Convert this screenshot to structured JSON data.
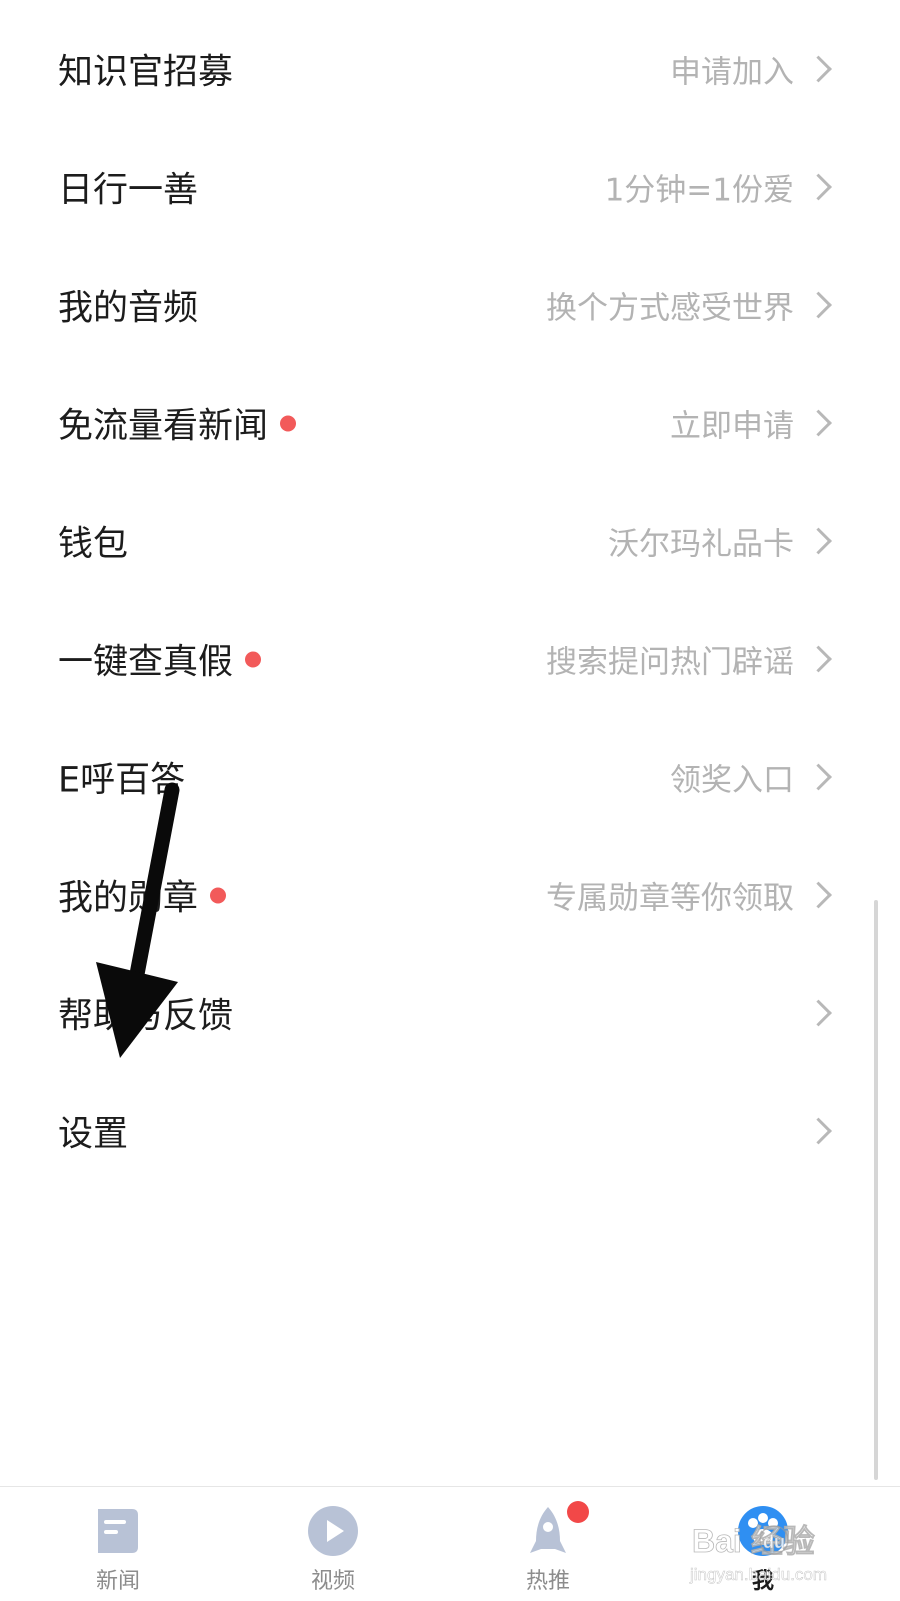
{
  "menu": {
    "items": [
      {
        "label": "知识官招募",
        "desc": "申请加入",
        "dot": false
      },
      {
        "label": "日行一善",
        "desc": "1分钟=1份爱",
        "dot": false
      },
      {
        "label": "我的音频",
        "desc": "换个方式感受世界",
        "dot": false
      },
      {
        "label": "免流量看新闻",
        "desc": "立即申请",
        "dot": true
      },
      {
        "label": "钱包",
        "desc": "沃尔玛礼品卡",
        "dot": false
      },
      {
        "label": "一键查真假",
        "desc": "搜索提问热门辟谣",
        "dot": true
      },
      {
        "label": "E呼百答",
        "desc": "领奖入口",
        "dot": false
      },
      {
        "label": "我的勋章",
        "desc": "专属勋章等你领取",
        "dot": true
      },
      {
        "label": "帮助与反馈",
        "desc": "",
        "dot": false
      },
      {
        "label": "设置",
        "desc": "",
        "dot": false
      }
    ]
  },
  "tabbar": {
    "tabs": [
      {
        "label": "新闻",
        "icon": "news-icon",
        "active": false
      },
      {
        "label": "视频",
        "icon": "play-icon",
        "active": false
      },
      {
        "label": "热推",
        "icon": "rocket-icon",
        "active": false,
        "badge": true
      },
      {
        "label": "我",
        "icon": "paw-icon",
        "active": true
      }
    ]
  },
  "watermark": {
    "brand_text": "Bai  经验",
    "du_text": "du",
    "url": "jingyan.baidu.com"
  },
  "colors": {
    "red_dot": "#f25a5a",
    "accent_blue": "#2f8ff2",
    "tab_icon_gray": "#b8c2d6"
  }
}
